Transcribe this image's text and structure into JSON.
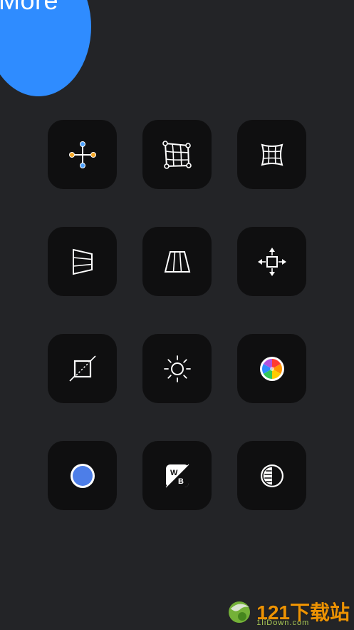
{
  "header": {
    "more_label": "More"
  },
  "tools": [
    {
      "icon": "move-points-icon"
    },
    {
      "icon": "mesh-warp-icon"
    },
    {
      "icon": "grid-warp-icon"
    },
    {
      "icon": "perspective-vertical-icon"
    },
    {
      "icon": "perspective-horizontal-icon"
    },
    {
      "icon": "move-arrows-icon"
    },
    {
      "icon": "crop-icon"
    },
    {
      "icon": "brightness-icon"
    },
    {
      "icon": "color-wheel-icon"
    },
    {
      "icon": "color-fill-icon"
    },
    {
      "icon": "white-balance-icon"
    },
    {
      "icon": "contrast-icon"
    }
  ],
  "white_balance_badge": {
    "w": "W",
    "b": "B"
  },
  "watermark": {
    "text": "121下载站",
    "domain": "1liDown.com"
  },
  "colors": {
    "background": "#232427",
    "tile": "#0f0f10",
    "accent": "#2f8cff"
  }
}
